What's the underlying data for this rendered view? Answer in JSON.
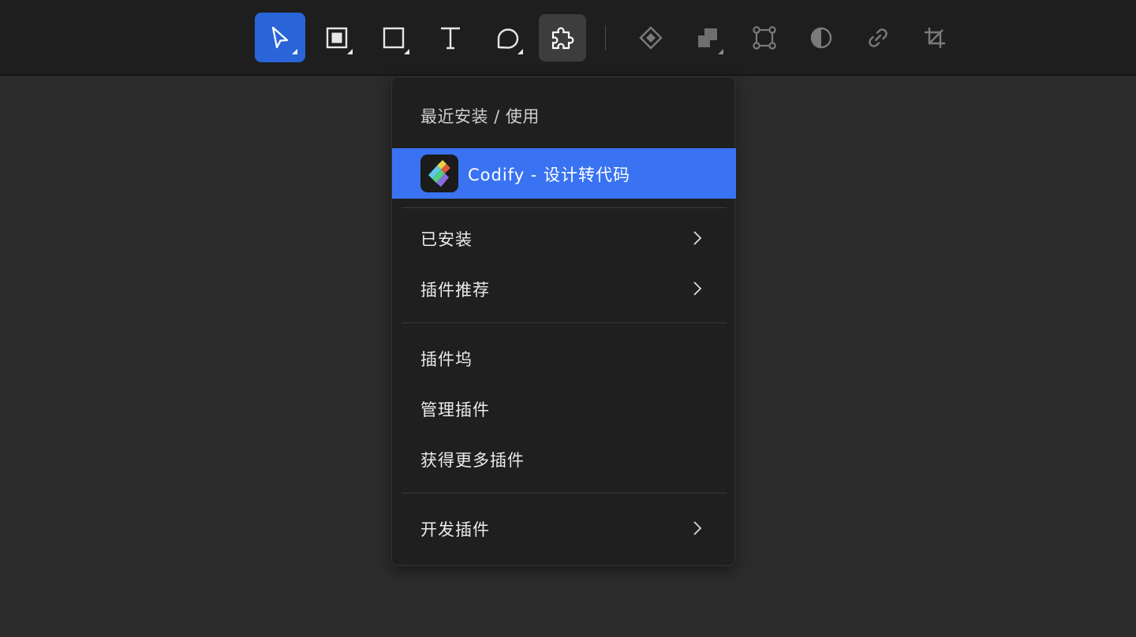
{
  "toolbar": {
    "tools": [
      {
        "name": "move-tool",
        "icon": "cursor-arrow-icon",
        "active": true
      },
      {
        "name": "frame-tool",
        "icon": "frame-icon"
      },
      {
        "name": "rectangle-tool",
        "icon": "rectangle-icon"
      },
      {
        "name": "text-tool",
        "icon": "text-icon"
      },
      {
        "name": "comment-tool",
        "icon": "speech-bubble-icon"
      },
      {
        "name": "plugin-tool",
        "icon": "puzzle-icon",
        "active": true
      },
      {
        "name": "component-tool",
        "icon": "diamond-icon"
      },
      {
        "name": "boolean-tool",
        "icon": "boolean-union-icon"
      },
      {
        "name": "vector-edit-tool",
        "icon": "vector-points-icon"
      },
      {
        "name": "mask-tool",
        "icon": "half-circle-icon"
      },
      {
        "name": "link-tool",
        "icon": "link-icon"
      },
      {
        "name": "crop-tool",
        "icon": "crop-icon"
      }
    ],
    "colors": {
      "select_active": "#2a64d9",
      "plugin_active": "#3d3d3d"
    }
  },
  "menu": {
    "heading": "最近安装 / 使用",
    "recent_plugin": {
      "label": "Codify - 设计转代码",
      "icon": "codify-logo-icon"
    },
    "installed": "已安装",
    "recommended": "插件推荐",
    "dock": "插件坞",
    "manage": "管理插件",
    "get_more": "获得更多插件",
    "develop": "开发插件",
    "highlight_color": "#3a73f2"
  }
}
